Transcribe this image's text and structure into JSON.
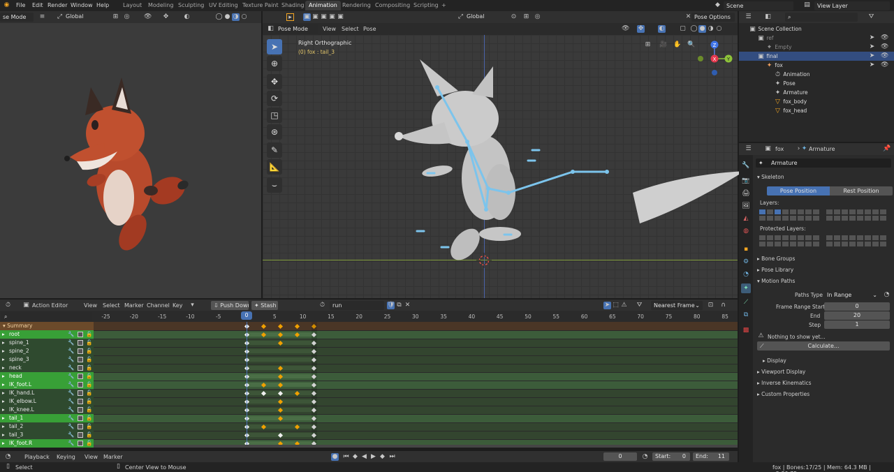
{
  "topbar": {
    "menus": [
      "File",
      "Edit",
      "Render",
      "Window",
      "Help"
    ],
    "workspaces": [
      "Layout",
      "Modeling",
      "Sculpting",
      "UV Editing",
      "Texture Paint",
      "Shading",
      "Animation",
      "Rendering",
      "Compositing",
      "Scripting"
    ],
    "active_workspace": "Animation",
    "scene": "Scene",
    "view_layer": "View Layer"
  },
  "left_viewport": {
    "mode": "se Mode",
    "orientation": "Global"
  },
  "main_viewport": {
    "orientation": "Global",
    "pose_options": "Pose Options",
    "mode": "Pose Mode",
    "menus": [
      "View",
      "Select",
      "Pose"
    ],
    "view_label": "Right Orthographic",
    "active_label": "(0) fox : tail_3",
    "gizmo_axes": [
      "X",
      "Y",
      "Z"
    ]
  },
  "action_editor": {
    "editor_label": "Action Editor",
    "menus": [
      "View",
      "Select",
      "Marker",
      "Channel",
      "Key"
    ],
    "push_down": "Push Down",
    "stash": "Stash",
    "action_name": "run",
    "snapping": "Nearest Frame",
    "ruler_ticks": [
      "-25",
      "-20",
      "-15",
      "-10",
      "-5",
      "0",
      "5",
      "10",
      "15",
      "20",
      "25",
      "30",
      "35",
      "40",
      "45",
      "50",
      "55",
      "60",
      "65",
      "70",
      "75",
      "80",
      "85"
    ],
    "current_frame_marker": "0",
    "summary": "Summary",
    "channels": [
      {
        "name": "root",
        "selected": true
      },
      {
        "name": "spine_1",
        "selected": false
      },
      {
        "name": "spine_2",
        "selected": false
      },
      {
        "name": "spine_3",
        "selected": false
      },
      {
        "name": "neck",
        "selected": false
      },
      {
        "name": "head",
        "selected": true
      },
      {
        "name": "IK_foot.L",
        "selected": true
      },
      {
        "name": "IK_hand.L",
        "selected": false
      },
      {
        "name": "IK_elbow.L",
        "selected": false
      },
      {
        "name": "IK_knee.L",
        "selected": false
      },
      {
        "name": "tail_1",
        "selected": true
      },
      {
        "name": "tail_2",
        "selected": false
      },
      {
        "name": "tail_3",
        "selected": false
      },
      {
        "name": "IK_foot.R",
        "selected": true
      }
    ]
  },
  "timeline": {
    "menus": [
      "Playback",
      "Keying",
      "View",
      "Marker"
    ],
    "current_frame": "0",
    "start_label": "Start:",
    "start": "0",
    "end_label": "End:",
    "end": "11"
  },
  "statusbar": {
    "left": "Select",
    "middle": "Center View to Mouse",
    "right": "fox | Bones:17/25 | Mem: 64.3 MB | v2.80.75"
  },
  "outliner": {
    "items": [
      {
        "label": "Scene Collection",
        "depth": 0
      },
      {
        "label": "ref",
        "depth": 1,
        "dim": true
      },
      {
        "label": "Empty",
        "depth": 2,
        "dim": true
      },
      {
        "label": "final",
        "depth": 1,
        "active": true
      },
      {
        "label": "fox",
        "depth": 2
      },
      {
        "label": "Animation",
        "depth": 3
      },
      {
        "label": "Pose",
        "depth": 3
      },
      {
        "label": "Armature",
        "depth": 3
      },
      {
        "label": "fox_body",
        "depth": 3
      },
      {
        "label": "fox_head",
        "depth": 3
      }
    ]
  },
  "properties": {
    "object": "fox",
    "data_type": "Armature",
    "data_name": "Armature",
    "skeleton_label": "Skeleton",
    "pose_position": "Pose Position",
    "rest_position": "Rest Position",
    "layers_label": "Layers:",
    "protected_layers_label": "Protected Layers:",
    "bone_groups": "Bone Groups",
    "pose_library": "Pose Library",
    "motion_paths": "Motion Paths",
    "paths_type_label": "Paths Type",
    "paths_type": "In Range",
    "frame_range_start_label": "Frame Range Start",
    "frame_range_start": "0",
    "end_label": "End",
    "end": "20",
    "step_label": "Step",
    "step": "1",
    "nothing_msg": "Nothing to show yet...",
    "calculate": "Calculate...",
    "display": "Display",
    "viewport_display": "Viewport Display",
    "inverse_kinematics": "Inverse Kinematics",
    "custom_properties": "Custom Properties"
  },
  "colors": {
    "accent": "#4772b3",
    "channel_selected": "#38a037",
    "bone": "#7cc4ec",
    "keyframe": "#f0a000"
  }
}
